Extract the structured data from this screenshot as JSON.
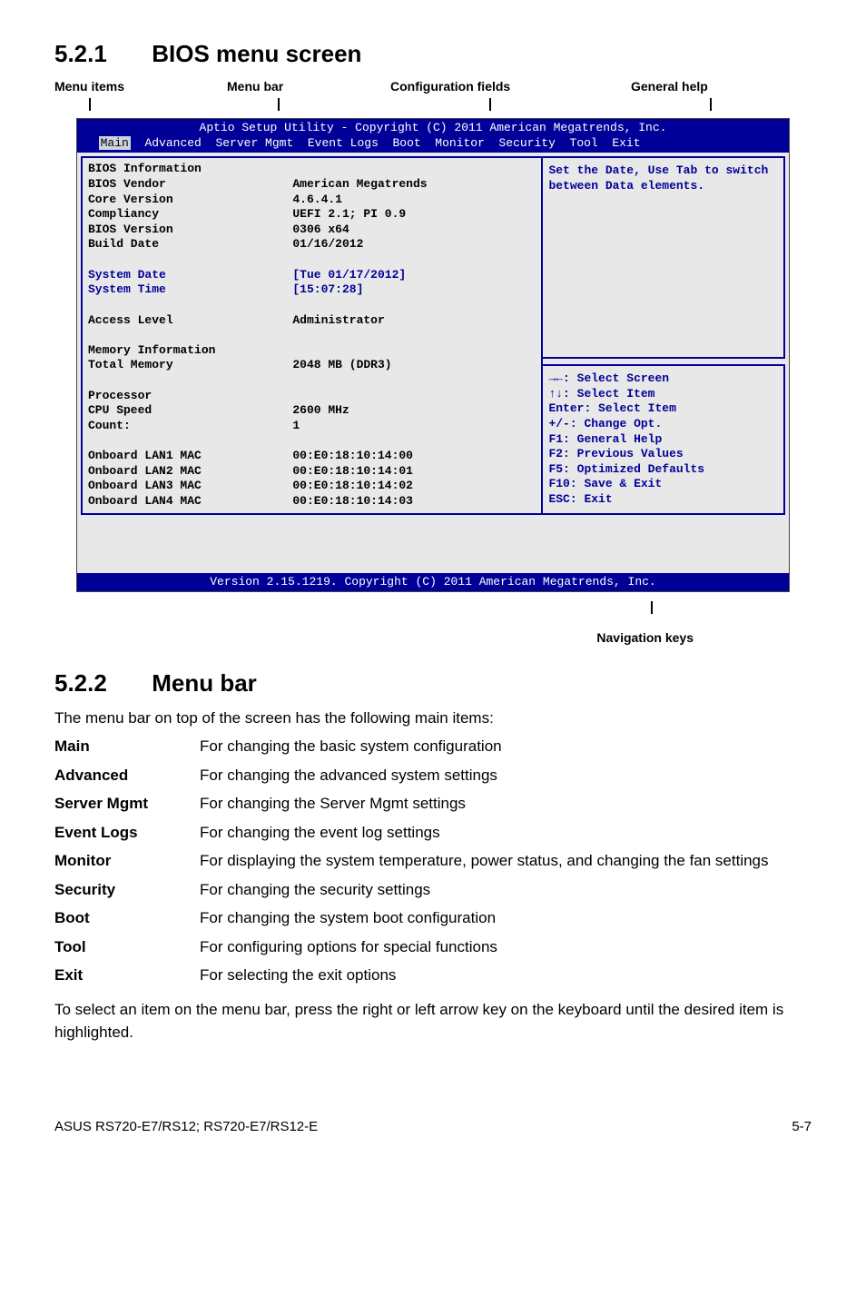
{
  "headings": {
    "s521_num": "5.2.1",
    "s521_title": "BIOS menu screen",
    "s522_num": "5.2.2",
    "s522_title": "Menu bar"
  },
  "top_labels": {
    "menu_items": "Menu items",
    "menu_bar": "Menu bar",
    "config_fields": "Configuration fields",
    "general_help": "General help"
  },
  "bios": {
    "header_line1": "Aptio Setup Utility - Copyright (C) 2011 American Megatrends, Inc.",
    "tabs": {
      "selected": "Main",
      "rest": "Advanced  Server Mgmt  Event Logs  Boot  Monitor  Security  Tool  Exit"
    },
    "left": {
      "bios_info": "BIOS Information",
      "vendor": "BIOS Vendor",
      "core": "Core Version",
      "compliancy": "Compliancy",
      "bversion": "BIOS Version",
      "bdate": "Build Date",
      "sdate": "System Date",
      "stime": "System Time",
      "access": "Access Level",
      "meminfo": "Memory Information",
      "tmem": "Total Memory",
      "proc": "Processor",
      "cpuspd": "CPU Speed",
      "count": "Count:",
      "mac1": "Onboard LAN1 MAC",
      "mac2": "Onboard LAN2 MAC",
      "mac3": "Onboard LAN3 MAC",
      "mac4": "Onboard LAN4 MAC"
    },
    "mid": {
      "vendor": "American Megatrends",
      "core": "4.6.4.1",
      "compliancy": "UEFI 2.1; PI 0.9",
      "bversion": "0306 x64",
      "bdate": "01/16/2012",
      "sdate": "[Tue 01/17/2012]",
      "stime": "[15:07:28]",
      "access": "Administrator",
      "tmem": "2048 MB (DDR3)",
      "cpuspd": "2600 MHz",
      "count": "1",
      "mac1": "00:E0:18:10:14:00",
      "mac2": "00:E0:18:10:14:01",
      "mac3": "00:E0:18:10:14:02",
      "mac4": "00:E0:18:10:14:03"
    },
    "help_top": "Set the Date, Use Tab to switch between Data elements.",
    "help_bot": {
      "l1": "→←: Select Screen",
      "l2": "↑↓:  Select Item",
      "l3": "Enter: Select Item",
      "l4": "+/-: Change Opt.",
      "l5": "F1: General Help",
      "l6": "F2: Previous Values",
      "l7": "F5: Optimized Defaults",
      "l8": "F10: Save & Exit",
      "l9": "ESC: Exit"
    },
    "footer": "Version 2.15.1219. Copyright (C) 2011 American Megatrends, Inc."
  },
  "nav_keys_label": "Navigation keys",
  "menubar_intro": "The menu bar on top of the screen has the following main items:",
  "definitions": [
    {
      "term": "Main",
      "desc": "For changing the basic system configuration"
    },
    {
      "term": "Advanced",
      "desc": "For changing the advanced system settings"
    },
    {
      "term": "Server Mgmt",
      "desc": "For changing the Server Mgmt settings"
    },
    {
      "term": "Event Logs",
      "desc": "For changing the event log settings"
    },
    {
      "term": "Monitor",
      "desc": "For displaying the system temperature, power status, and changing the fan settings"
    },
    {
      "term": "Security",
      "desc": "For changing the security settings"
    },
    {
      "term": "Boot",
      "desc": "For changing the system boot configuration"
    },
    {
      "term": "Tool",
      "desc": "For configuring options for special functions"
    },
    {
      "term": "Exit",
      "desc": "For selecting the exit options"
    }
  ],
  "note": "To select an item on the menu bar, press the right or left arrow key on the keyboard until the desired item is highlighted.",
  "footer": {
    "left": "ASUS RS720-E7/RS12; RS720-E7/RS12-E",
    "right": "5-7"
  }
}
